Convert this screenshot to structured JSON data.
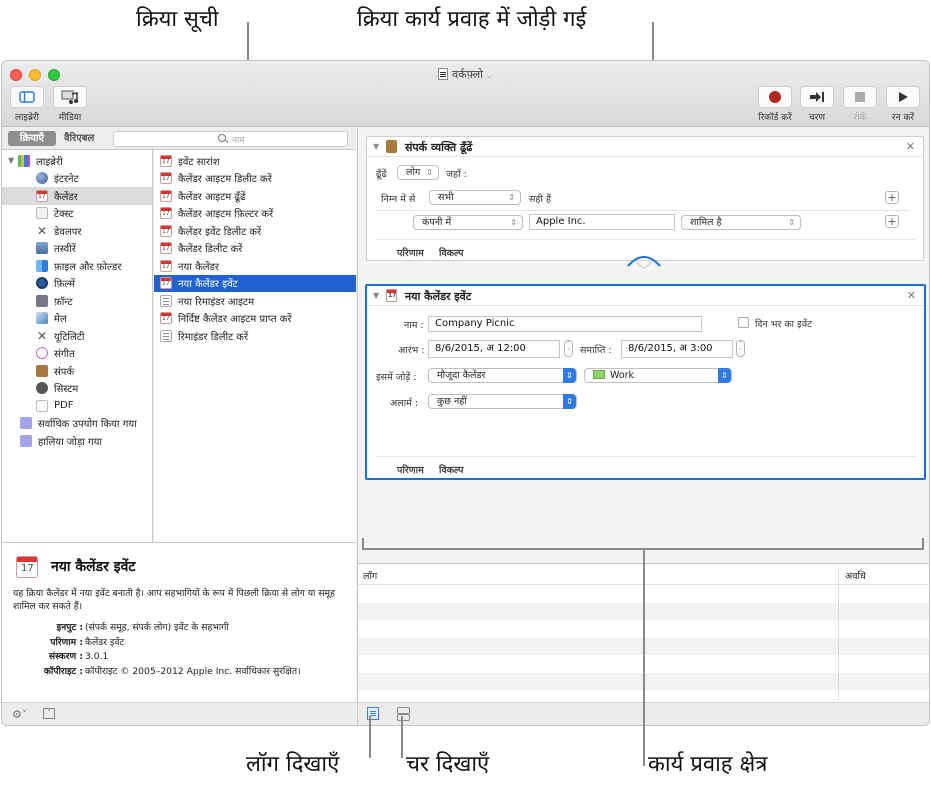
{
  "callouts": {
    "action_list": "क्रिया सूची",
    "action_added": "क्रिया कार्य प्रवाह में जोड़ी गई",
    "show_log": "लॉग दिखाएँ",
    "show_variables": "चर दिखाएँ",
    "workflow_area": "कार्य प्रवाह क्षेत्र"
  },
  "window": {
    "title": "वर्कफ़्लो",
    "toolbar": {
      "library": "लाइब्रेरी",
      "media": "मीडिया",
      "record": "रिकॉर्ड करें",
      "step": "चरण",
      "stop": "रोकें",
      "run": "रन करें"
    },
    "colors": {
      "record": "#b0281f",
      "selection": "#1e63d0",
      "workflow_selected_border": "#1f6fd2"
    }
  },
  "left": {
    "tabs": {
      "actions": "क्रियाएँ",
      "variables": "वैरिएबल"
    },
    "search_placeholder": "नाम",
    "library": {
      "root": "लाइब्रेरी",
      "items": [
        {
          "label": "इंटरनेट",
          "icon": "globe-icon"
        },
        {
          "label": "कैलेंडर",
          "icon": "calendar-icon",
          "selected": true
        },
        {
          "label": "टेक्स्ट",
          "icon": "text-icon"
        },
        {
          "label": "डेवलपर",
          "icon": "developer-icon"
        },
        {
          "label": "तस्वीरें",
          "icon": "photos-icon"
        },
        {
          "label": "फ़ाइल और फ़ोल्डर",
          "icon": "finder-icon"
        },
        {
          "label": "फ़िल्में",
          "icon": "quicktime-icon"
        },
        {
          "label": "फ़ॉन्ट",
          "icon": "font-icon"
        },
        {
          "label": "मेल",
          "icon": "mail-icon"
        },
        {
          "label": "यूटिलिटी",
          "icon": "utility-icon"
        },
        {
          "label": "संगीत",
          "icon": "music-icon"
        },
        {
          "label": "संपर्क",
          "icon": "contacts-icon"
        },
        {
          "label": "सिस्टम",
          "icon": "system-icon"
        },
        {
          "label": "PDF",
          "icon": "pdf-icon"
        }
      ],
      "smart_groups": [
        {
          "label": "सर्वाधिक उपयोग किया गया",
          "icon": "smart-folder-icon"
        },
        {
          "label": "हालिया जोड़ा गया",
          "icon": "smart-folder-icon"
        }
      ]
    },
    "actions": [
      {
        "label": "इवेंट सारांश",
        "icon": "calendar-icon"
      },
      {
        "label": "कैलेंडर आइटम डिलीट करें",
        "icon": "calendar-icon"
      },
      {
        "label": "कैलेंडर आइटम ढूँढें",
        "icon": "calendar-icon"
      },
      {
        "label": "कैलेंडर आइटम फ़िल्टर करें",
        "icon": "calendar-icon"
      },
      {
        "label": "कैलेंडर इवेंट डिलीट करें",
        "icon": "calendar-icon"
      },
      {
        "label": "कैलेंडर डिलीट करें",
        "icon": "calendar-icon"
      },
      {
        "label": "नया कैलेंडर",
        "icon": "calendar-icon"
      },
      {
        "label": "नया कैलेंडर इवेंट",
        "icon": "calendar-icon",
        "selected": true
      },
      {
        "label": "नया रिमाइंडर आइटम",
        "icon": "reminder-icon"
      },
      {
        "label": "निर्दिष्ट कैलेंडर आइटम प्राप्त करें",
        "icon": "calendar-icon"
      },
      {
        "label": "रिमाइंडर डिलीट करें",
        "icon": "reminder-icon"
      }
    ],
    "description": {
      "title": "नया कैलेंडर इवेंट",
      "body": "यह क्रिया कैलेंडर में नया इवेंट बनाती है। आप सहभागियों के रूप में पिछली क्रिया से लोग या समूह शामिल कर सकते हैं।",
      "meta": [
        {
          "key": "इनपुट :",
          "value": "(संपर्क समूह, संपर्क लोग) इवेंट के सहभागी"
        },
        {
          "key": "परिणाम :",
          "value": "कैलेंडर इवेंट"
        },
        {
          "key": "संस्करण :",
          "value": "3.0.1"
        },
        {
          "key": "कॉपीराइट :",
          "value": "कॉपीराइट © 2005–2012 Apple Inc.  सर्वाधिकार सुरक्षित।"
        }
      ]
    }
  },
  "workflow": {
    "find_people": {
      "title": "संपर्क व्यक्ति ढूँढें",
      "find_label": "ढूँढें",
      "find_value": "लोग",
      "where_label": "जहाँ :",
      "any_prefix": "निम्न में से",
      "any_value": "सभी",
      "any_suffix": "सही हैं",
      "criteria_field": "कंपनी में",
      "criteria_text": "Apple Inc.",
      "criteria_op": "शामिल है",
      "footer_results": "परिणाम",
      "footer_options": "विकल्प"
    },
    "new_event": {
      "title": "नया कैलेंडर इवेंट",
      "name_label": "नाम :",
      "name_value": "Company Picnic",
      "all_day_label": "दिन भर का इवेंट",
      "all_day_checked": false,
      "start_label": "आरंभ :",
      "start_value": "8/6/2015, अ 12:00",
      "end_label": "समाप्ति :",
      "end_value": "8/6/2015, अ  3:00",
      "add_to_label": "इसमें जोड़ें :",
      "add_to_value": "मौजूदा कैलेंडर",
      "calendar_value": "Work",
      "calendar_color": "#8fd46a",
      "alarm_label": "अलार्म :",
      "alarm_value": "कुछ नहीं",
      "footer_results": "परिणाम",
      "footer_options": "विकल्प"
    }
  },
  "log": {
    "col_log": "लॉग",
    "col_duration": "अवधि"
  }
}
